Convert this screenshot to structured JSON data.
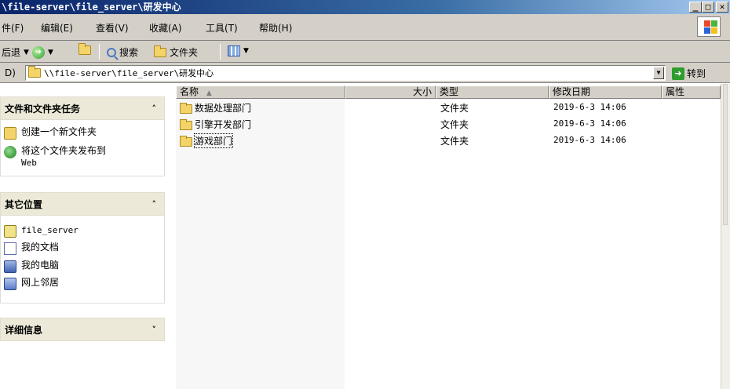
{
  "window": {
    "title": "\\file-server\\file_server\\研发中心"
  },
  "menu": [
    {
      "label": "件(F)"
    },
    {
      "label": "编辑(E)"
    },
    {
      "label": "查看(V)"
    },
    {
      "label": "收藏(A)"
    },
    {
      "label": "工具(T)"
    },
    {
      "label": "帮助(H)"
    }
  ],
  "toolbar": {
    "back_label": "后退",
    "search_label": "搜索",
    "folders_label": "文件夹"
  },
  "address": {
    "label": "D)",
    "path": "\\\\file-server\\file_server\\研发中心",
    "go_label": "转到"
  },
  "taskpane": {
    "file_tasks": {
      "title": "文件和文件夹任务",
      "chevron": "˄",
      "items": [
        {
          "label": "创建一个新文件夹",
          "icon": "new-folder-icon"
        },
        {
          "label": "将这个文件夹发布到",
          "label2": "Web",
          "icon": "globe-icon"
        }
      ]
    },
    "other_places": {
      "title": "其它位置",
      "chevron": "˄",
      "items": [
        {
          "label": "file_server",
          "icon": "server-folder-icon"
        },
        {
          "label": "我的文档",
          "icon": "documents-icon"
        },
        {
          "label": "我的电脑",
          "icon": "computer-icon"
        },
        {
          "label": "网上邻居",
          "icon": "network-icon"
        }
      ]
    },
    "details": {
      "title": "详细信息",
      "chevron": "˅"
    }
  },
  "filelist": {
    "columns": {
      "name": "名称",
      "size": "大小",
      "type": "类型",
      "modified": "修改日期",
      "attributes": "属性"
    },
    "rows": [
      {
        "name": "数据处理部门",
        "type": "文件夹",
        "modified": "2019-6-3 14:06"
      },
      {
        "name": "引擎开发部门",
        "type": "文件夹",
        "modified": "2019-6-3 14:06"
      },
      {
        "name": "游戏部门",
        "type": "文件夹",
        "modified": "2019-6-3 14:06"
      }
    ]
  },
  "colors": {
    "titlebar_start": "#0a246a",
    "chrome": "#d4d0c8",
    "panel_header": "#ece9d8"
  }
}
